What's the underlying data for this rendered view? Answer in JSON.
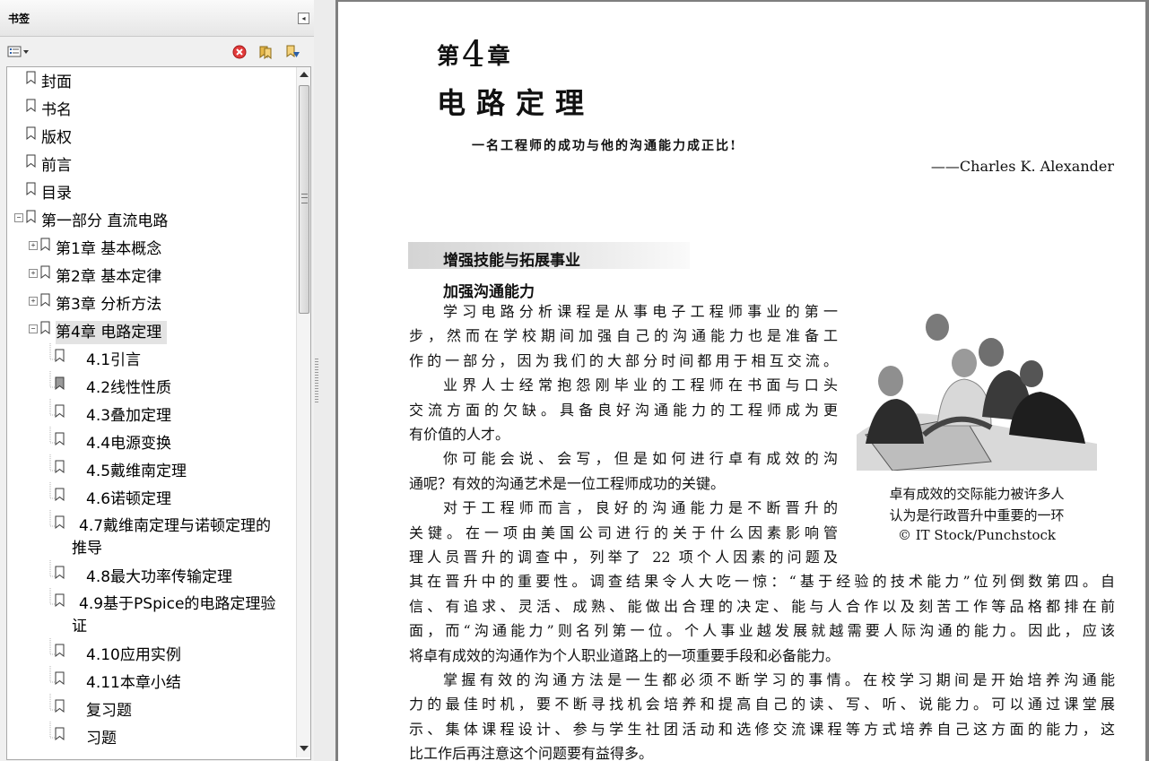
{
  "bookmarks": {
    "title": "书签",
    "toolbar": {
      "options_icon": "options-menu-icon",
      "delete_icon": "delete-bookmark-icon",
      "expand_icon": "expand-bookmark-icon",
      "find_icon": "find-bookmark-icon"
    },
    "items": [
      {
        "label": "封面",
        "level": 0,
        "toggle": "",
        "selected": false
      },
      {
        "label": "书名",
        "level": 0,
        "toggle": "",
        "selected": false
      },
      {
        "label": "版权",
        "level": 0,
        "toggle": "",
        "selected": false
      },
      {
        "label": "前言",
        "level": 0,
        "toggle": "",
        "selected": false
      },
      {
        "label": "目录",
        "level": 0,
        "toggle": "",
        "selected": false
      },
      {
        "label": "第一部分  直流电路",
        "level": 0,
        "toggle": "⊟",
        "selected": false
      },
      {
        "label": "第1章  基本概念",
        "level": 1,
        "toggle": "⊞",
        "selected": false
      },
      {
        "label": "第2章  基本定律",
        "level": 1,
        "toggle": "⊞",
        "selected": false
      },
      {
        "label": "第3章  分析方法",
        "level": 1,
        "toggle": "⊞",
        "selected": false
      },
      {
        "label": "第4章  电路定理",
        "level": 1,
        "toggle": "⊟",
        "selected": true
      },
      {
        "label": "4.1引言",
        "level": 2,
        "toggle": "",
        "selected": false
      },
      {
        "label": "4.2线性性质",
        "level": 2,
        "toggle": "",
        "selected": false
      },
      {
        "label": "4.3叠加定理",
        "level": 2,
        "toggle": "",
        "selected": false
      },
      {
        "label": "4.4电源变换",
        "level": 2,
        "toggle": "",
        "selected": false
      },
      {
        "label": "4.5戴维南定理",
        "level": 2,
        "toggle": "",
        "selected": false
      },
      {
        "label": "4.6诺顿定理",
        "level": 2,
        "toggle": "",
        "selected": false
      },
      {
        "label": "4.7戴维南定理与诺顿定理的推导",
        "level": 2,
        "toggle": "",
        "selected": false,
        "wrap": true
      },
      {
        "label": "4.8最大功率传输定理",
        "level": 2,
        "toggle": "",
        "selected": false
      },
      {
        "label": "4.9基于PSpice的电路定理验证",
        "level": 2,
        "toggle": "",
        "selected": false,
        "wrap": true
      },
      {
        "label": "4.10应用实例",
        "level": 2,
        "toggle": "",
        "selected": false
      },
      {
        "label": "4.11本章小结",
        "level": 2,
        "toggle": "",
        "selected": false
      },
      {
        "label": "复习题",
        "level": 2,
        "toggle": "",
        "selected": false
      },
      {
        "label": "习题",
        "level": 2,
        "toggle": "",
        "selected": false
      }
    ]
  },
  "page": {
    "chapter_prefix": "第",
    "chapter_number": "4",
    "chapter_suffix": "章",
    "chapter_title": "电路定理",
    "epigraph": "一名工程师的成功与他的沟通能力成正比!",
    "attribution": "——Charles K. Alexander",
    "section_title": "增强技能与拓展事业",
    "subsection_title": "加强沟通能力",
    "lines": [
      {
        "text": "学习电路分析课程是从事电子工程师事业的第一",
        "width": "narrow",
        "indent": true
      },
      {
        "text": "步，然而在学校期间加强自己的沟通能力也是准备工",
        "width": "narrow",
        "indent": false
      },
      {
        "text": "作的一部分，因为我们的大部分时间都用于相互交流。",
        "width": "narrow",
        "indent": false
      },
      {
        "text": "业界人士经常抱怨刚毕业的工程师在书面与口头",
        "width": "narrow",
        "indent": true
      },
      {
        "text": "交流方面的欠缺。具备良好沟通能力的工程师成为更",
        "width": "narrow",
        "indent": false
      },
      {
        "text": "有价值的人才。",
        "width": "narrow",
        "indent": false,
        "last": true
      },
      {
        "text": "你可能会说、会写，但是如何进行卓有成效的沟",
        "width": "narrow",
        "indent": true
      },
      {
        "text": "通呢？有效的沟通艺术是一位工程师成功的关键。",
        "width": "narrow",
        "indent": false,
        "last": true
      },
      {
        "text": "对于工程师而言，良好的沟通能力是不断晋升的",
        "width": "narrow",
        "indent": true
      },
      {
        "text": "关键。在一项由美国公司进行的关于什么因素影响管",
        "width": "narrow",
        "indent": false
      },
      {
        "text": "理人员晋升的调查中，列举了 22 项个人因素的问题及",
        "width": "narrow",
        "indent": false
      },
      {
        "text": "其在晋升中的重要性。调查结果令人大吃一惊：“基于经验的技术能力”位列倒数第四。自",
        "width": "wide",
        "indent": false
      },
      {
        "text": "信、有追求、灵活、成熟、能做出合理的决定、能与人合作以及刻苦工作等品格都排在前",
        "width": "wide",
        "indent": false
      },
      {
        "text": "面，而“沟通能力”则名列第一位。个人事业越发展就越需要人际沟通的能力。因此，应该",
        "width": "wide",
        "indent": false
      },
      {
        "text": "将卓有成效的沟通作为个人职业道路上的一项重要手段和必备能力。",
        "width": "wide",
        "indent": false,
        "last": true
      },
      {
        "text": "掌握有效的沟通方法是一生都必须不断学习的事情。在校学习期间是开始培养沟通能",
        "width": "wide",
        "indent": true
      },
      {
        "text": "力的最佳时机，要不断寻找机会培养和提高自己的读、写、听、说能力。可以通过课堂展",
        "width": "wide",
        "indent": false
      },
      {
        "text": "示、集体课程设计、参与学生社团活动和选修交流课程等方式培养自己这方面的能力，这",
        "width": "wide",
        "indent": false
      },
      {
        "text": "比工作后再注意这个问题要有益得多。",
        "width": "wide",
        "indent": false,
        "last": true
      }
    ],
    "caption": [
      "卓有成效的交际能力被许多人",
      "认为是行政晋升中重要的一环",
      "© IT Stock/Punchstock"
    ]
  },
  "colors": {
    "panel_bg": "#f0f0f0",
    "selection": "#e3e3e3",
    "doc_bg": "#7f7f7f",
    "delete_red": "#e23b3b",
    "bookmark_blue": "#2a5ea8"
  }
}
